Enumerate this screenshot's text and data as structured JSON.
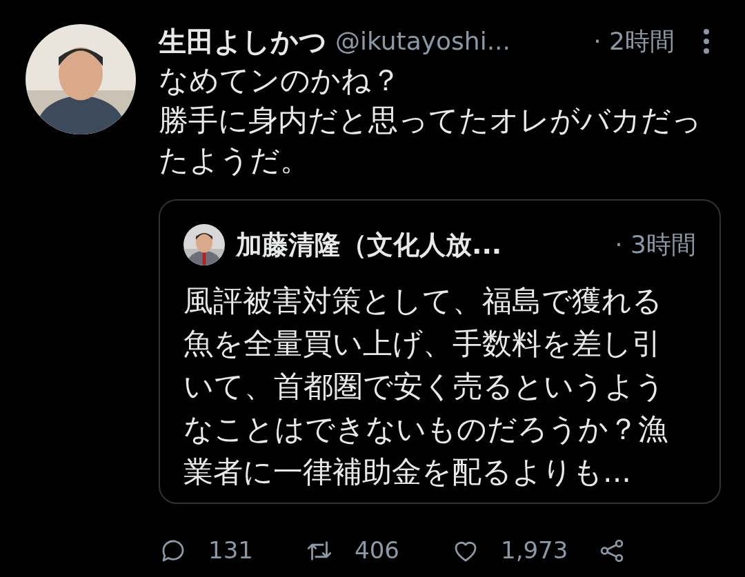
{
  "tweet": {
    "name": "生田よしかつ",
    "handle": "@ikutayoshi...",
    "time": "· 2時間",
    "paragraphs": [
      "なめてンのかね？",
      "勝手に身内だと思ってたオレがバカだったようだ。"
    ],
    "quote": {
      "name": "加藤清隆（文化人放...",
      "time": "· 3時間",
      "text": "風評被害対策として、福島で獲れる魚を全量買い上げ、手数料を差し引いて、首都圏で安く売るというようなことはできないものだろうか？漁業者に一律補助金を配るよりも..."
    },
    "actions": [
      {
        "kind": "reply",
        "count": "131"
      },
      {
        "kind": "retweet",
        "count": "406"
      },
      {
        "kind": "like",
        "count": "1,973"
      },
      {
        "kind": "share"
      }
    ]
  }
}
